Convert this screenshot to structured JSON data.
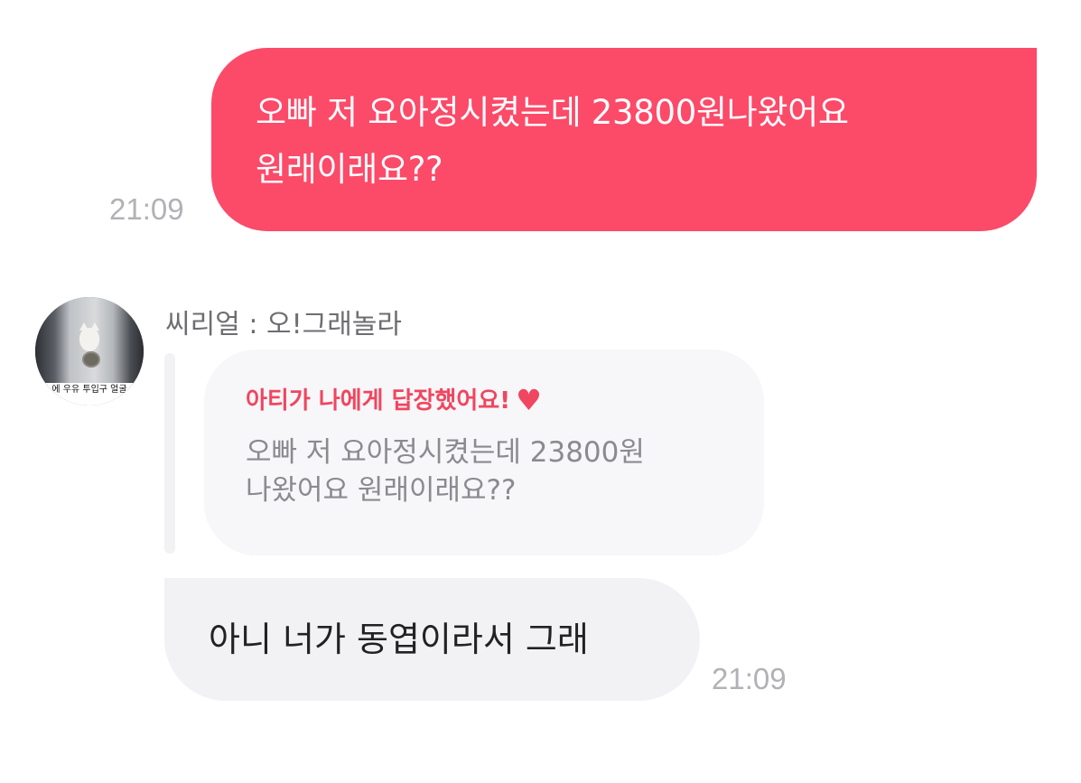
{
  "outgoing_message": {
    "text": "오빠 저 요아정시켰는데 23800원나왔어요\n원래이래요??",
    "time": "21:09",
    "bubble_color": "#fc4a69"
  },
  "incoming": {
    "avatar_caption": "에 우유 투입구 얼굴",
    "sender_name": "씨리얼 : 오!그래놀라",
    "reply_card": {
      "header": "아티가 나에게 답장했어요!",
      "heart": "♥",
      "quoted_text": "오빠 저 요아정시켰는데 23800원\n나왔어요 원래이래요??",
      "accent_color": "#f0465f"
    },
    "message": {
      "text": "아니 너가 동엽이라서 그래",
      "time": "21:09"
    }
  }
}
